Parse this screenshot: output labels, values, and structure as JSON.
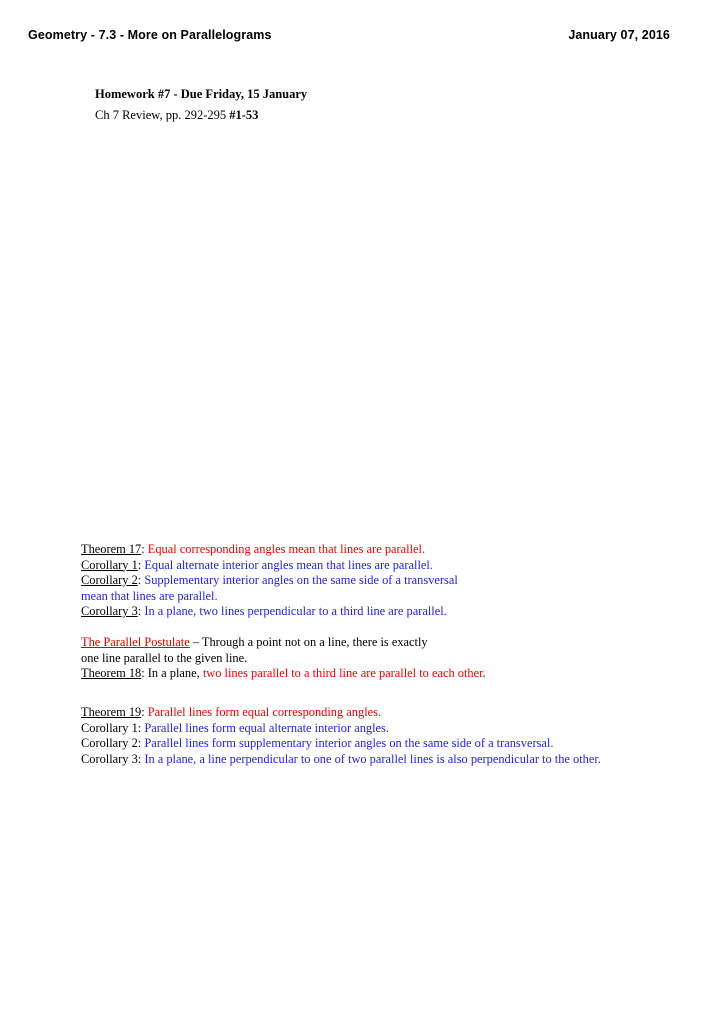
{
  "header": {
    "title": "Geometry - 7.3 - More on Parallelograms",
    "date": "January 07, 2016"
  },
  "homework": {
    "title": "Homework #7 - Due Friday, 15 January",
    "assignment_text": "Ch 7 Review, pp. 292-295 ",
    "assignment_problems": "#1-53"
  },
  "colors": {
    "red": "#ee0000",
    "blue": "#2222dd",
    "black": "#000000",
    "label_red": "#d40000",
    "background": "#ffffff"
  },
  "blocks": [
    {
      "id": "block-1",
      "lines": [
        {
          "label": "Theorem 17",
          "label_underlined": true,
          "separator": ": ",
          "statement": "Equal corresponding angles mean that lines are parallel.",
          "statement_color": "red"
        },
        {
          "label": "Corollary 1",
          "label_underlined": true,
          "separator": ": ",
          "statement": "Equal alternate interior angles mean that lines are parallel.",
          "statement_color": "blue"
        },
        {
          "label": "Corollary 2",
          "label_underlined": true,
          "separator": ": ",
          "statement": "Supplementary interior angles on the same side of a transversal",
          "statement_color": "blue",
          "continuation": "mean that lines are parallel.",
          "continuation_color": "blue"
        },
        {
          "label": "Corollary 3",
          "label_underlined": true,
          "separator": ": ",
          "statement": "In a plane, two lines perpendicular to a third line are parallel.",
          "statement_color": "blue"
        }
      ]
    },
    {
      "id": "block-2",
      "lines": [
        {
          "label": "The Parallel Postulate",
          "label_underlined": true,
          "label_color": "red",
          "separator": " – ",
          "statement": "Through a point not on a line, there is exactly",
          "statement_color": "black",
          "continuation": "one line parallel to the given line.",
          "continuation_color": "black"
        },
        {
          "label": "Theorem 18",
          "label_underlined": true,
          "separator": ": ",
          "prefix": "In a plane, ",
          "prefix_color": "black",
          "statement": "two lines parallel to a third line are parallel to each other",
          "statement_color": "red",
          "suffix": ".",
          "suffix_color": "black"
        }
      ]
    },
    {
      "id": "block-3",
      "lines": [
        {
          "label": "Theorem 19",
          "label_underlined": true,
          "separator": ": ",
          "statement": "Parallel lines form equal corresponding angles.",
          "statement_color": "red"
        },
        {
          "label": "Corollary 1",
          "label_underlined": false,
          "separator": ": ",
          "statement": "Parallel lines form equal alternate interior angles.",
          "statement_color": "blue"
        },
        {
          "label": "Corollary 2",
          "label_underlined": false,
          "separator": ": ",
          "statement": "Parallel lines form supplementary interior angles on the same side of a transversal.",
          "statement_color": "blue"
        },
        {
          "label": "Corollary 3",
          "label_underlined": false,
          "separator": ": ",
          "statement": "In a plane, a line perpendicular to one of two parallel lines is also perpendicular to the other.",
          "statement_color": "blue"
        }
      ]
    }
  ]
}
